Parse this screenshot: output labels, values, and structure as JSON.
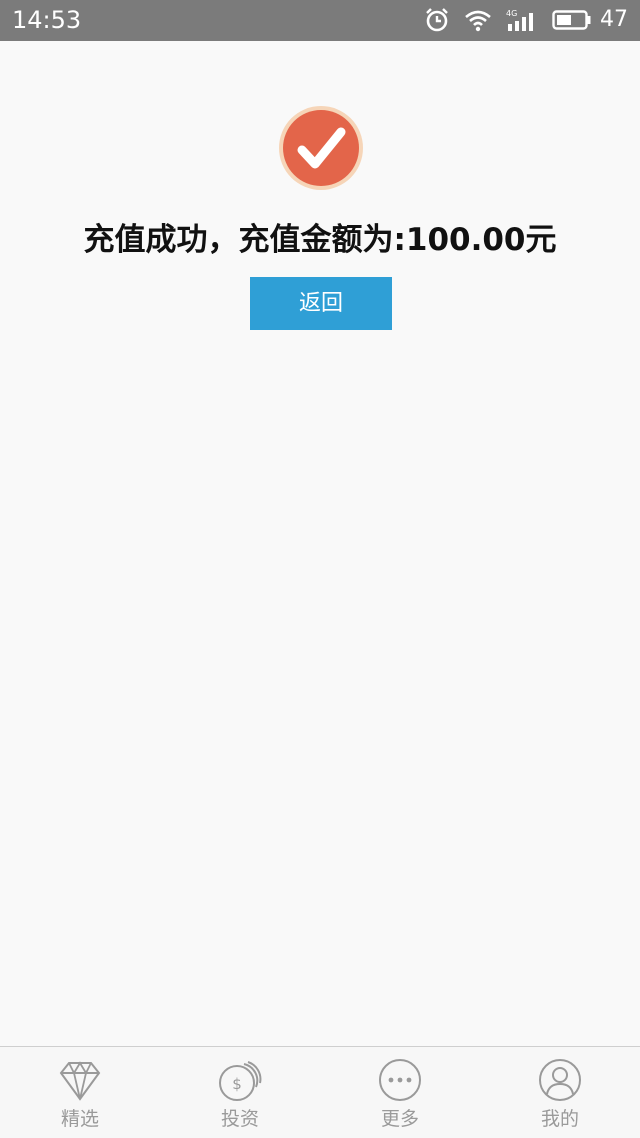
{
  "status_bar": {
    "time": "14:53",
    "network": "4G",
    "battery": "47"
  },
  "success": {
    "message": "充值成功，充值金额为:100.00元",
    "back_label": "返回"
  },
  "tabs": [
    {
      "label": "精选",
      "icon": "diamond-icon"
    },
    {
      "label": "投资",
      "icon": "coins-icon"
    },
    {
      "label": "更多",
      "icon": "more-icon"
    },
    {
      "label": "我的",
      "icon": "user-icon"
    }
  ],
  "colors": {
    "status_bar_bg": "#7b7b7b",
    "check_circle": "#e3654a",
    "check_ring": "#f5c9a8",
    "button_bg": "#2f9fd6",
    "tab_inactive": "#9a9a9a"
  }
}
